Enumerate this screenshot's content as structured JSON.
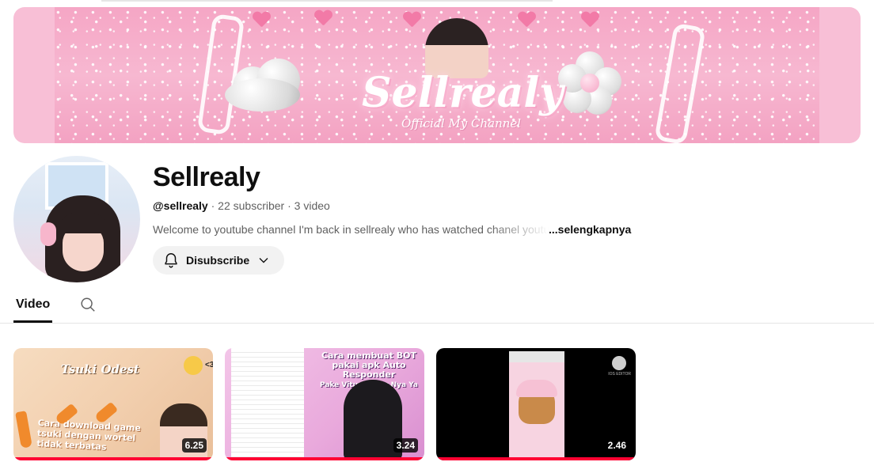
{
  "banner": {
    "title": "Sellrealy",
    "subtitle": "Official My Channel"
  },
  "channel": {
    "name": "Sellrealy",
    "handle": "@sellrealy",
    "separator": " · ",
    "subscribers": "22 subscriber",
    "videos_count": "3 video",
    "description": "Welcome to youtube channel I'm back in sellrealy who has watched chanel youtube",
    "more_label": "...selengkapnya"
  },
  "subscribe_button": {
    "label": "Disubscribe",
    "icon": "bell-icon",
    "dropdown_icon": "chevron-down-icon"
  },
  "tabs": [
    {
      "label": "Video",
      "selected": true
    },
    {
      "label": "",
      "icon": "search-icon"
    }
  ],
  "videos": [
    {
      "duration": "6.25",
      "watched_fraction": 1.0,
      "thumbnail_text_1": "Tsuki Odest",
      "thumbnail_text_2": "Cara download game tsuki dengan wortel tidak terbatas",
      "thumbnail_badge": "<3"
    },
    {
      "duration": "3.24",
      "watched_fraction": 1.0,
      "thumbnail_text_1": "Cara membuat BOT pakai apk Auto Responder",
      "thumbnail_text_2": "Pake Vitur Pintar Nya Ya"
    },
    {
      "duration": "2.46",
      "watched_fraction": 1.0,
      "thumbnail_text_1": "IOS EDITOR"
    }
  ],
  "colors": {
    "accent_red": "#ff0033",
    "banner_pink": "#f8bfd6",
    "button_bg": "#f2f2f2"
  }
}
